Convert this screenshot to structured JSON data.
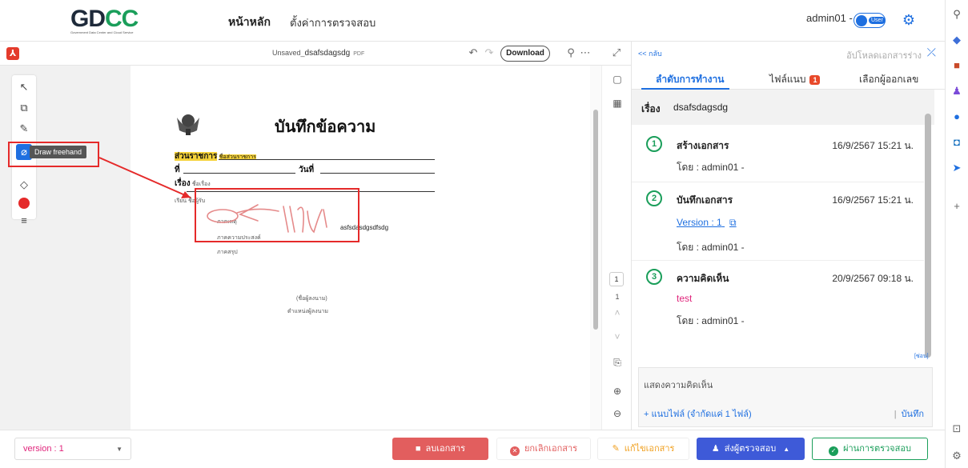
{
  "header": {
    "logo_text": "GDCC",
    "logo_subtext": "Government Data Center and Cloud Service",
    "nav_home": "หน้าหลัก",
    "nav_settings": "ตั้งค่าการตรวจสอบ",
    "user_name": "admin01 -",
    "user_toggle_label": "User"
  },
  "viewer": {
    "doc_prefix": "Unsaved_",
    "doc_name": "dsafsdagsdg",
    "doc_ext": "PDF",
    "download_label": "Download",
    "tooltip": "Draw freehand"
  },
  "page": {
    "title": "บันทึกข้อความ",
    "row1_label": "ส่วนราชการ",
    "row1_value": "ชื่อส่วนราชการ",
    "row2_label_a": "ที่",
    "row2_label_b": "วันที่",
    "row3_label": "เรื่อง",
    "row3_value": "ชื่อเรื่อง",
    "row4": "เรียน ชื่อผู้รับ",
    "item1": "ภาคเหตุ",
    "item2": "ภาคความประสงค์",
    "item3": "ภาคสรุป",
    "body_text": "asfsdasdgsdfsdg",
    "signer": "(ชื่อผู้ลงนาม)",
    "signer_position": "ตำแหน่งผู้ลงนาม"
  },
  "mini": {
    "page_number": "1",
    "page_total": "1"
  },
  "panel": {
    "back_label": "<< กลับ",
    "upload_label": "อัปโหลดเอกสารร่าง",
    "tabs": [
      {
        "label": "ลำดับการทำงาน"
      },
      {
        "label": "ไฟล์แนบ",
        "badge": "1"
      },
      {
        "label": "เลือกผู้ออกเลข"
      }
    ],
    "subject_label": "เรื่อง",
    "subject_value": "dsafsdagsdg",
    "steps": [
      {
        "num": "1",
        "title": "สร้างเอกสาร",
        "date": "16/9/2567 15:21 น.",
        "by": "โดย : admin01 -"
      },
      {
        "num": "2",
        "title": "บันทึกเอกสาร",
        "date": "16/9/2567 15:21 น.",
        "link": "Version : 1",
        "by": "โดย : admin01 -"
      },
      {
        "num": "3",
        "title": "ความคิดเห็น",
        "date": "20/9/2567 09:18 น.",
        "comment": "test",
        "by": "โดย : admin01 -"
      }
    ],
    "tiny_link": "[ซ่อน]",
    "comment_placeholder": "แสดงความคิดเห็น",
    "attach_label": "แนบไฟล์ (จำกัดแค่ 1 ไฟล์)",
    "save_label": "บันทึก"
  },
  "bottom": {
    "version_label": "version : 1",
    "delete_label": "ลบเอกสาร",
    "cancel_label": "ยกเลิกเอกสาร",
    "edit_label": "แก้ไขเอกสาร",
    "send_label": "ส่งผู้ตรวจสอบ",
    "pass_label": "ผ่านการตรวจสอบ"
  },
  "colors": {
    "accent": "#1e6fe0",
    "success": "#1a9e5a",
    "danger": "#e25e5e",
    "annotation_red": "#e52a2a",
    "highlight": "#f5d23a"
  }
}
